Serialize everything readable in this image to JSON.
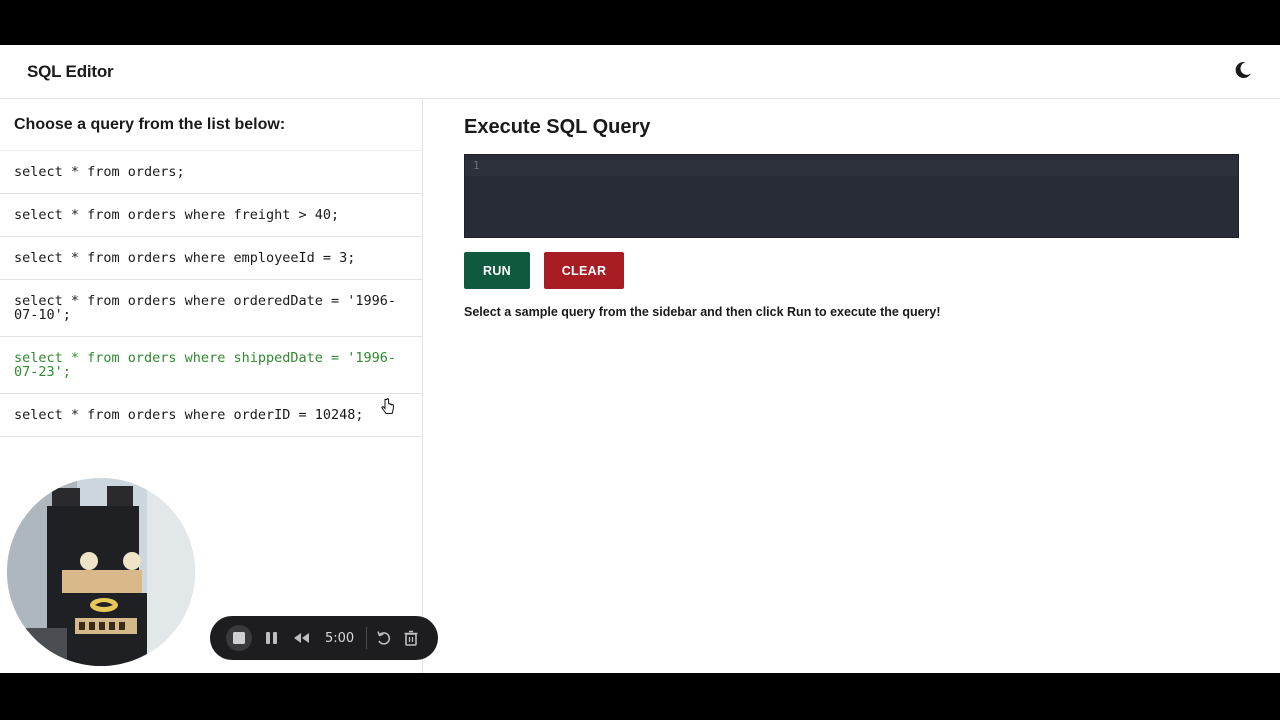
{
  "header": {
    "title": "SQL Editor",
    "theme_icon": "moon-icon"
  },
  "sidebar": {
    "heading": "Choose a query from the list below:",
    "queries": [
      "select * from orders;",
      "select * from orders where freight > 40;",
      "select * from orders where employeeId = 3;",
      "select * from orders where orderedDate = '1996-07-10';",
      "select * from orders where shippedDate = '1996-07-23';",
      "select * from orders where orderID = 10248;"
    ],
    "active_index": 4
  },
  "main": {
    "title": "Execute SQL Query",
    "editor": {
      "line_number": "1",
      "content": ""
    },
    "run_label": "RUN",
    "clear_label": "CLEAR",
    "hint": "Select a sample query from the sidebar and then click Run to execute the query!"
  },
  "recorder": {
    "time": "5:00"
  },
  "colors": {
    "run": "#0f5a3e",
    "clear": "#a81c23",
    "active_query": "#2e8b2e",
    "editor_bg": "#282c34"
  }
}
